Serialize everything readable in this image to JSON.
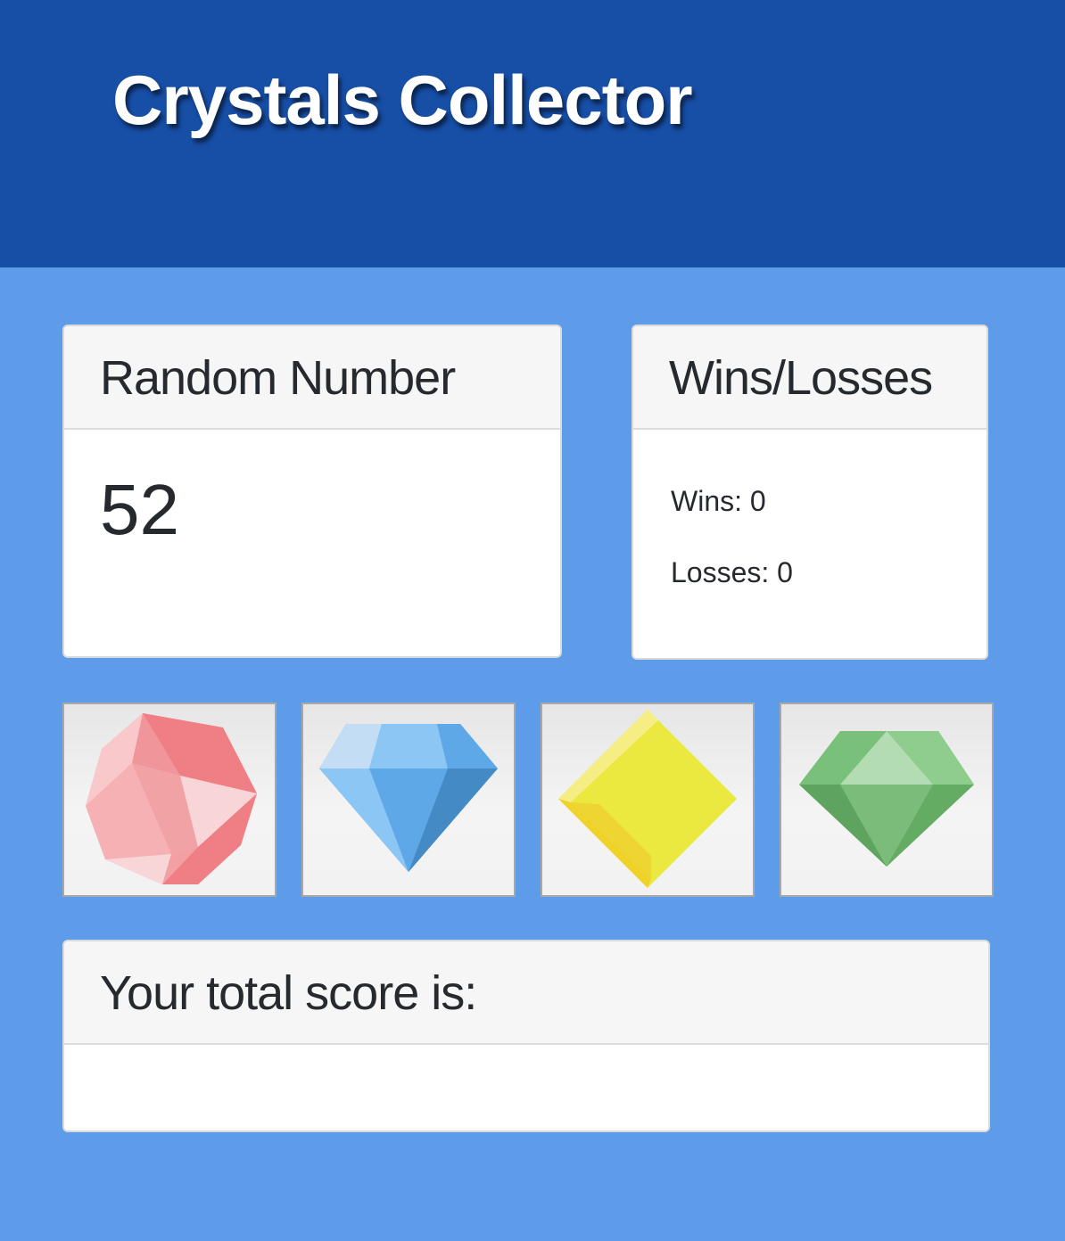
{
  "header": {
    "title": "Crystals Collector"
  },
  "random_card": {
    "title": "Random Number",
    "value": "52"
  },
  "wins_losses_card": {
    "title": "Wins/Losses",
    "wins_text": "Wins: 0",
    "losses_text": "Losses: 0"
  },
  "crystals": [
    {
      "name": "red-crystal-icon",
      "color": "#ef7f84"
    },
    {
      "name": "blue-diamond-icon",
      "color": "#5fa8e8"
    },
    {
      "name": "yellow-gem-icon",
      "color": "#ebe840"
    },
    {
      "name": "green-diamond-icon",
      "color": "#7cbc7b"
    }
  ],
  "score_card": {
    "title": "Your total score is:",
    "value": ""
  },
  "colors": {
    "header_bg": "#174ea6",
    "page_bg": "#5e9be9"
  }
}
